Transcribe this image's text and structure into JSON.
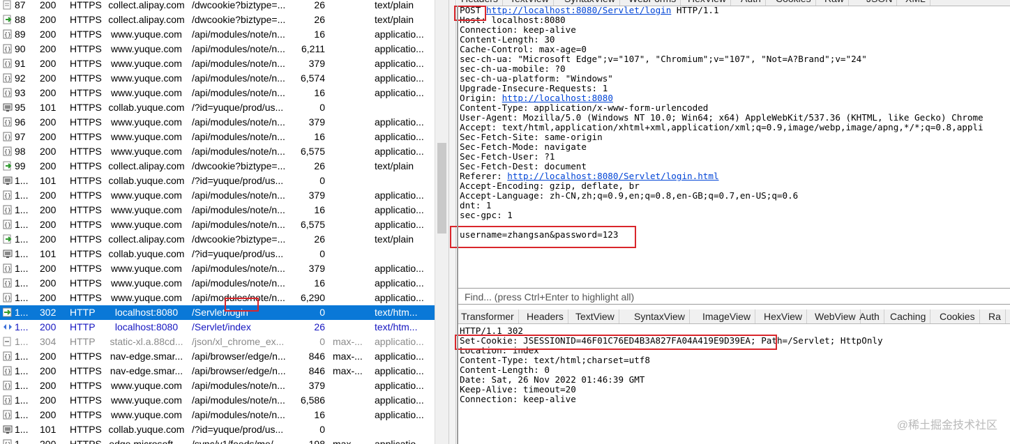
{
  "sessions": [
    {
      "num": "87",
      "result": "200",
      "protocol": "HTTPS",
      "host": "collect.alipay.com",
      "url": "/dwcookie?biztype=...",
      "body": "26",
      "caching": "",
      "ctype": "text/plain",
      "icon": "document-icon",
      "style": ""
    },
    {
      "num": "88",
      "result": "200",
      "protocol": "HTTPS",
      "host": "collect.alipay.com",
      "url": "/dwcookie?biztype=...",
      "body": "26",
      "caching": "",
      "ctype": "text/plain",
      "icon": "arrow-right-icon",
      "style": ""
    },
    {
      "num": "89",
      "result": "200",
      "protocol": "HTTPS",
      "host": "www.yuque.com",
      "url": "/api/modules/note/n...",
      "body": "16",
      "caching": "",
      "ctype": "applicatio...",
      "icon": "json-icon",
      "style": ""
    },
    {
      "num": "90",
      "result": "200",
      "protocol": "HTTPS",
      "host": "www.yuque.com",
      "url": "/api/modules/note/n...",
      "body": "6,211",
      "caching": "",
      "ctype": "applicatio...",
      "icon": "json-icon",
      "style": ""
    },
    {
      "num": "91",
      "result": "200",
      "protocol": "HTTPS",
      "host": "www.yuque.com",
      "url": "/api/modules/note/n...",
      "body": "379",
      "caching": "",
      "ctype": "applicatio...",
      "icon": "json-icon",
      "style": ""
    },
    {
      "num": "92",
      "result": "200",
      "protocol": "HTTPS",
      "host": "www.yuque.com",
      "url": "/api/modules/note/n...",
      "body": "6,574",
      "caching": "",
      "ctype": "applicatio...",
      "icon": "json-icon",
      "style": ""
    },
    {
      "num": "93",
      "result": "200",
      "protocol": "HTTPS",
      "host": "www.yuque.com",
      "url": "/api/modules/note/n...",
      "body": "16",
      "caching": "",
      "ctype": "applicatio...",
      "icon": "json-icon",
      "style": ""
    },
    {
      "num": "95",
      "result": "101",
      "protocol": "HTTPS",
      "host": "collab.yuque.com",
      "url": "/?id=yuque/prod/us...",
      "body": "0",
      "caching": "",
      "ctype": "",
      "icon": "websocket-icon",
      "style": ""
    },
    {
      "num": "96",
      "result": "200",
      "protocol": "HTTPS",
      "host": "www.yuque.com",
      "url": "/api/modules/note/n...",
      "body": "379",
      "caching": "",
      "ctype": "applicatio...",
      "icon": "json-icon",
      "style": ""
    },
    {
      "num": "97",
      "result": "200",
      "protocol": "HTTPS",
      "host": "www.yuque.com",
      "url": "/api/modules/note/n...",
      "body": "16",
      "caching": "",
      "ctype": "applicatio...",
      "icon": "json-icon",
      "style": ""
    },
    {
      "num": "98",
      "result": "200",
      "protocol": "HTTPS",
      "host": "www.yuque.com",
      "url": "/api/modules/note/n...",
      "body": "6,575",
      "caching": "",
      "ctype": "applicatio...",
      "icon": "json-icon",
      "style": ""
    },
    {
      "num": "99",
      "result": "200",
      "protocol": "HTTPS",
      "host": "collect.alipay.com",
      "url": "/dwcookie?biztype=...",
      "body": "26",
      "caching": "",
      "ctype": "text/plain",
      "icon": "arrow-right-icon",
      "style": ""
    },
    {
      "num": "1...",
      "result": "101",
      "protocol": "HTTPS",
      "host": "collab.yuque.com",
      "url": "/?id=yuque/prod/us...",
      "body": "0",
      "caching": "",
      "ctype": "",
      "icon": "websocket-icon",
      "style": ""
    },
    {
      "num": "1...",
      "result": "200",
      "protocol": "HTTPS",
      "host": "www.yuque.com",
      "url": "/api/modules/note/n...",
      "body": "379",
      "caching": "",
      "ctype": "applicatio...",
      "icon": "json-icon",
      "style": ""
    },
    {
      "num": "1...",
      "result": "200",
      "protocol": "HTTPS",
      "host": "www.yuque.com",
      "url": "/api/modules/note/n...",
      "body": "16",
      "caching": "",
      "ctype": "applicatio...",
      "icon": "json-icon",
      "style": ""
    },
    {
      "num": "1...",
      "result": "200",
      "protocol": "HTTPS",
      "host": "www.yuque.com",
      "url": "/api/modules/note/n...",
      "body": "6,575",
      "caching": "",
      "ctype": "applicatio...",
      "icon": "json-icon",
      "style": ""
    },
    {
      "num": "1...",
      "result": "200",
      "protocol": "HTTPS",
      "host": "collect.alipay.com",
      "url": "/dwcookie?biztype=...",
      "body": "26",
      "caching": "",
      "ctype": "text/plain",
      "icon": "arrow-right-icon",
      "style": ""
    },
    {
      "num": "1...",
      "result": "101",
      "protocol": "HTTPS",
      "host": "collab.yuque.com",
      "url": "/?id=yuque/prod/us...",
      "body": "0",
      "caching": "",
      "ctype": "",
      "icon": "websocket-icon",
      "style": ""
    },
    {
      "num": "1...",
      "result": "200",
      "protocol": "HTTPS",
      "host": "www.yuque.com",
      "url": "/api/modules/note/n...",
      "body": "379",
      "caching": "",
      "ctype": "applicatio...",
      "icon": "json-icon",
      "style": ""
    },
    {
      "num": "1...",
      "result": "200",
      "protocol": "HTTPS",
      "host": "www.yuque.com",
      "url": "/api/modules/note/n...",
      "body": "16",
      "caching": "",
      "ctype": "applicatio...",
      "icon": "json-icon",
      "style": ""
    },
    {
      "num": "1...",
      "result": "200",
      "protocol": "HTTPS",
      "host": "www.yuque.com",
      "url": "/api/modules/note/n...",
      "body": "6,290",
      "caching": "",
      "ctype": "applicatio...",
      "icon": "json-icon",
      "style": ""
    },
    {
      "num": "1...",
      "result": "302",
      "protocol": "HTTP",
      "host": "localhost:8080",
      "url": "/Servlet/login",
      "body": "0",
      "caching": "",
      "ctype": "text/htm...",
      "icon": "redirect-icon",
      "style": "selected"
    },
    {
      "num": "1...",
      "result": "200",
      "protocol": "HTTP",
      "host": "localhost:8080",
      "url": "/Servlet/index",
      "body": "26",
      "caching": "",
      "ctype": "text/htm...",
      "icon": "html-icon",
      "style": "blue"
    },
    {
      "num": "1...",
      "result": "304",
      "protocol": "HTTP",
      "host": "static-xl.a.88cd...",
      "url": "/json/xl_chrome_ex...",
      "body": "0",
      "caching": "max-...",
      "ctype": "applicatio...",
      "icon": "not-modified-icon",
      "style": "grey"
    },
    {
      "num": "1...",
      "result": "200",
      "protocol": "HTTPS",
      "host": "nav-edge.smar...",
      "url": "/api/browser/edge/n...",
      "body": "846",
      "caching": "max-...",
      "ctype": "applicatio...",
      "icon": "json-icon",
      "style": ""
    },
    {
      "num": "1...",
      "result": "200",
      "protocol": "HTTPS",
      "host": "nav-edge.smar...",
      "url": "/api/browser/edge/n...",
      "body": "846",
      "caching": "max-...",
      "ctype": "applicatio...",
      "icon": "json-icon",
      "style": ""
    },
    {
      "num": "1...",
      "result": "200",
      "protocol": "HTTPS",
      "host": "www.yuque.com",
      "url": "/api/modules/note/n...",
      "body": "379",
      "caching": "",
      "ctype": "applicatio...",
      "icon": "json-icon",
      "style": ""
    },
    {
      "num": "1...",
      "result": "200",
      "protocol": "HTTPS",
      "host": "www.yuque.com",
      "url": "/api/modules/note/n...",
      "body": "6,586",
      "caching": "",
      "ctype": "applicatio...",
      "icon": "json-icon",
      "style": ""
    },
    {
      "num": "1...",
      "result": "200",
      "protocol": "HTTPS",
      "host": "www.yuque.com",
      "url": "/api/modules/note/n...",
      "body": "16",
      "caching": "",
      "ctype": "applicatio...",
      "icon": "json-icon",
      "style": ""
    },
    {
      "num": "1...",
      "result": "101",
      "protocol": "HTTPS",
      "host": "collab.yuque.com",
      "url": "/?id=yuque/prod/us...",
      "body": "0",
      "caching": "",
      "ctype": "",
      "icon": "websocket-icon",
      "style": ""
    },
    {
      "num": "1...",
      "result": "200",
      "protocol": "HTTPS",
      "host": "edge.microsoft....",
      "url": "/sync/v1/feeds/me/...",
      "body": "198",
      "caching": "max-...",
      "ctype": "applicatio...",
      "icon": "json-icon",
      "style": ""
    }
  ],
  "request_tabs": [
    "Headers",
    "TextView",
    "SyntaxView",
    "WebForms",
    "HexView",
    "Auth",
    "Cookies",
    "Raw",
    "JSON",
    "XML"
  ],
  "request": {
    "method": "POST",
    "url": "http://localhost:8080/Servlet/login",
    "version": "HTTP/1.1",
    "headers": [
      "Host: localhost:8080",
      "Connection: keep-alive",
      "Content-Length: 30",
      "Cache-Control: max-age=0",
      "sec-ch-ua: \"Microsoft Edge\";v=\"107\", \"Chromium\";v=\"107\", \"Not=A?Brand\";v=\"24\"",
      "sec-ch-ua-mobile: ?0",
      "sec-ch-ua-platform: \"Windows\"",
      "Upgrade-Insecure-Requests: 1"
    ],
    "origin_label": "Origin: ",
    "origin_url": "http://localhost:8080",
    "headers2": [
      "Content-Type: application/x-www-form-urlencoded",
      "User-Agent: Mozilla/5.0 (Windows NT 10.0; Win64; x64) AppleWebKit/537.36 (KHTML, like Gecko) Chrome",
      "Accept: text/html,application/xhtml+xml,application/xml;q=0.9,image/webp,image/apng,*/*;q=0.8,appli",
      "Sec-Fetch-Site: same-origin",
      "Sec-Fetch-Mode: navigate",
      "Sec-Fetch-User: ?1",
      "Sec-Fetch-Dest: document"
    ],
    "referer_label": "Referer: ",
    "referer_url": "http://localhost:8080/Servlet/login.html",
    "headers3": [
      "Accept-Encoding: gzip, deflate, br",
      "Accept-Language: zh-CN,zh;q=0.9,en;q=0.8,en-GB;q=0.7,en-US;q=0.6",
      "dnt: 1",
      "sec-gpc: 1"
    ],
    "body": "username=zhangsan&password=123"
  },
  "find_placeholder": "Find... (press Ctrl+Enter to highlight all)",
  "response_tabs": [
    "Transformer",
    "Headers",
    "TextView",
    "SyntaxView",
    "ImageView",
    "HexView",
    "WebView",
    "Auth",
    "Caching",
    "Cookies",
    "Ra"
  ],
  "response": {
    "status": "HTTP/1.1 302",
    "set_cookie": "Set-Cookie: JSESSIONID=46F01C76ED4B3A827FA04A419E9D39EA;",
    "set_cookie_rest": " Path=/Servlet; HttpOnly",
    "headers": [
      "Location: index",
      "Content-Type: text/html;charset=utf8",
      "Content-Length: 0",
      "Date: Sat, 26 Nov 2022 01:46:39 GMT",
      "Keep-Alive: timeout=20",
      "Connection: keep-alive"
    ]
  },
  "watermark": "@稀土掘金技术社区",
  "colors": {
    "selected_row": "#0a78d7",
    "highlight_box": "#d9262b",
    "link": "#0044d6"
  }
}
